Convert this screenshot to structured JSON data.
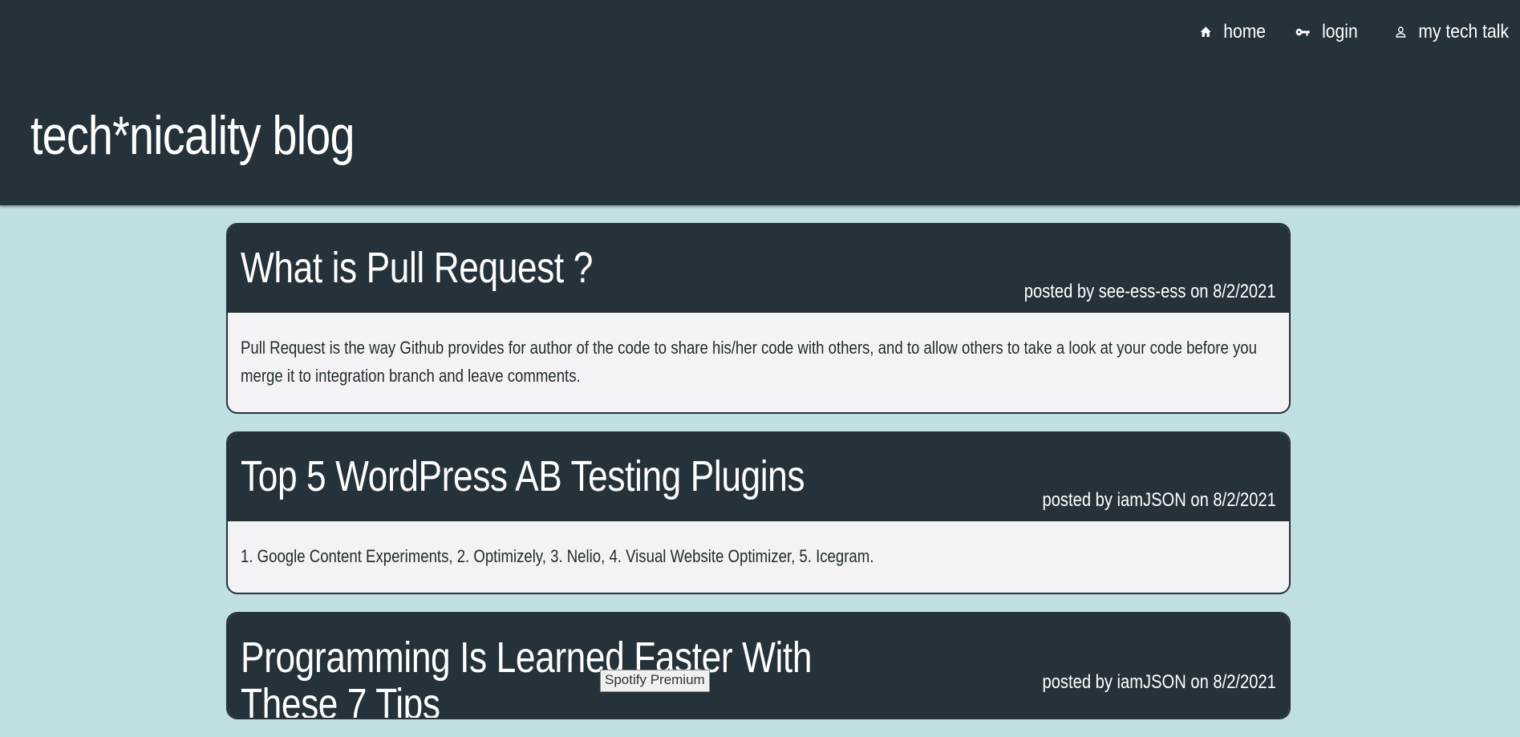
{
  "header": {
    "site_title": "tech*nicality blog",
    "nav": [
      {
        "label": "home",
        "icon": "home-icon"
      },
      {
        "label": "login",
        "icon": "key-icon"
      },
      {
        "label": "my tech talk",
        "icon": "person-icon"
      }
    ]
  },
  "posts": [
    {
      "title": "What is Pull Request ?",
      "meta": "posted by see-ess-ess on 8/2/2021",
      "body": "Pull Request is the way Github provides for author of the code to share his/her code with others, and to allow others to take a look at your code before you merge it to integration branch and leave comments."
    },
    {
      "title": "Top 5 WordPress AB Testing Plugins",
      "meta": "posted by iamJSON on 8/2/2021",
      "body": "1. Google Content Experiments, 2. Optimizely, 3. Nelio, 4. Visual Website Optimizer, 5. Icegram."
    },
    {
      "title_line1": "Programming Is Learned Faster With",
      "title_line2": "These 7 Tips",
      "meta": "posted by iamJSON on 8/2/2021"
    }
  ],
  "tooltip": "Spotify Premium",
  "colors": {
    "header_bg": "#253239",
    "page_bg": "#c0dfe3",
    "card_body_bg": "#f3f3f5",
    "text_light": "#ffffff"
  }
}
